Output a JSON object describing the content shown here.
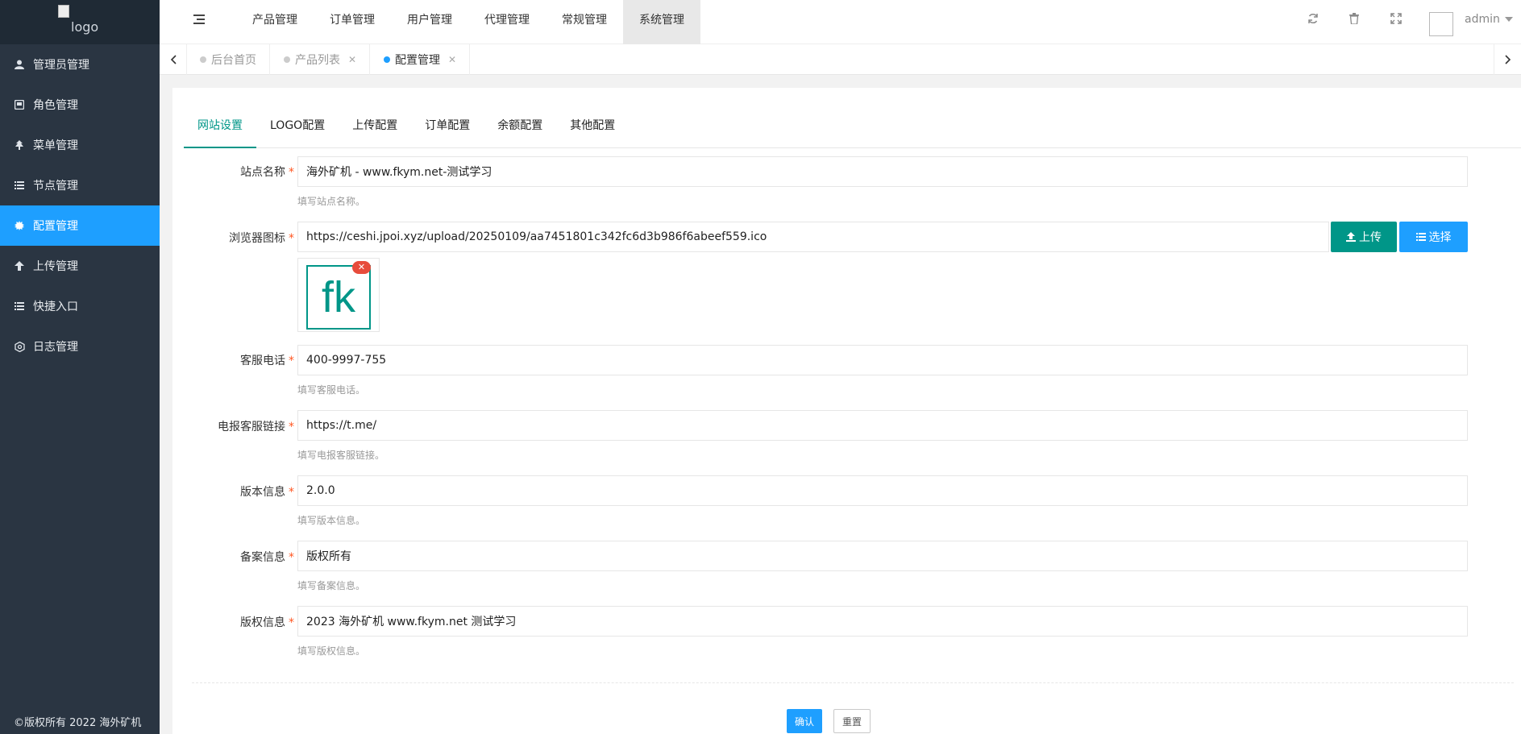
{
  "sidebar": {
    "logo_alt": "logo",
    "items": [
      {
        "label": "管理员管理",
        "icon": "user-icon"
      },
      {
        "label": "角色管理",
        "icon": "role-icon"
      },
      {
        "label": "菜单管理",
        "icon": "tree-icon"
      },
      {
        "label": "节点管理",
        "icon": "list-icon"
      },
      {
        "label": "配置管理",
        "icon": "gear-icon",
        "active": true
      },
      {
        "label": "上传管理",
        "icon": "upload-arrow-icon"
      },
      {
        "label": "快捷入口",
        "icon": "list-icon"
      },
      {
        "label": "日志管理",
        "icon": "log-icon"
      }
    ],
    "footer": "©版权所有 2022 海外矿机"
  },
  "header": {
    "nav": [
      "产品管理",
      "订单管理",
      "用户管理",
      "代理管理",
      "常规管理",
      "系统管理"
    ],
    "active_nav": "系统管理",
    "user": "admin"
  },
  "tabbar": {
    "tabs": [
      {
        "label": "后台首页"
      },
      {
        "label": "产品列表"
      },
      {
        "label": "配置管理"
      }
    ]
  },
  "settings": {
    "tabs": [
      "网站设置",
      "LOGO配置",
      "上传配置",
      "订单配置",
      "余额配置",
      "其他配置"
    ],
    "fields": {
      "site_name": {
        "label": "站点名称",
        "value": "海外矿机 - www.fkym.net-测试学习",
        "hint": "填写站点名称。"
      },
      "favicon": {
        "label": "浏览器图标",
        "value": "https://ceshi.jpoi.xyz/upload/20250109/aa7451801c342fc6d3b986f6abeef559.ico",
        "preview_text": "fk"
      },
      "phone": {
        "label": "客服电话",
        "value": "400-9997-755",
        "hint": "填写客服电话。"
      },
      "telegram": {
        "label": "电报客服链接",
        "value": "https://t.me/",
        "hint": "填写电报客服链接。"
      },
      "version": {
        "label": "版本信息",
        "value": "2.0.0",
        "hint": "填写版本信息。"
      },
      "record": {
        "label": "备案信息",
        "value": "版权所有",
        "hint": "填写备案信息。"
      },
      "copyright": {
        "label": "版权信息",
        "value": "2023 海外矿机 www.fkym.net 测试学习",
        "hint": "填写版权信息。"
      }
    },
    "buttons": {
      "upload": "上传",
      "choose": "选择",
      "confirm": "确认",
      "reset": "重置"
    }
  },
  "colors": {
    "primary": "#1e9fff",
    "green": "#009688",
    "sidebar": "#2a3542",
    "required": "#ff5722"
  }
}
